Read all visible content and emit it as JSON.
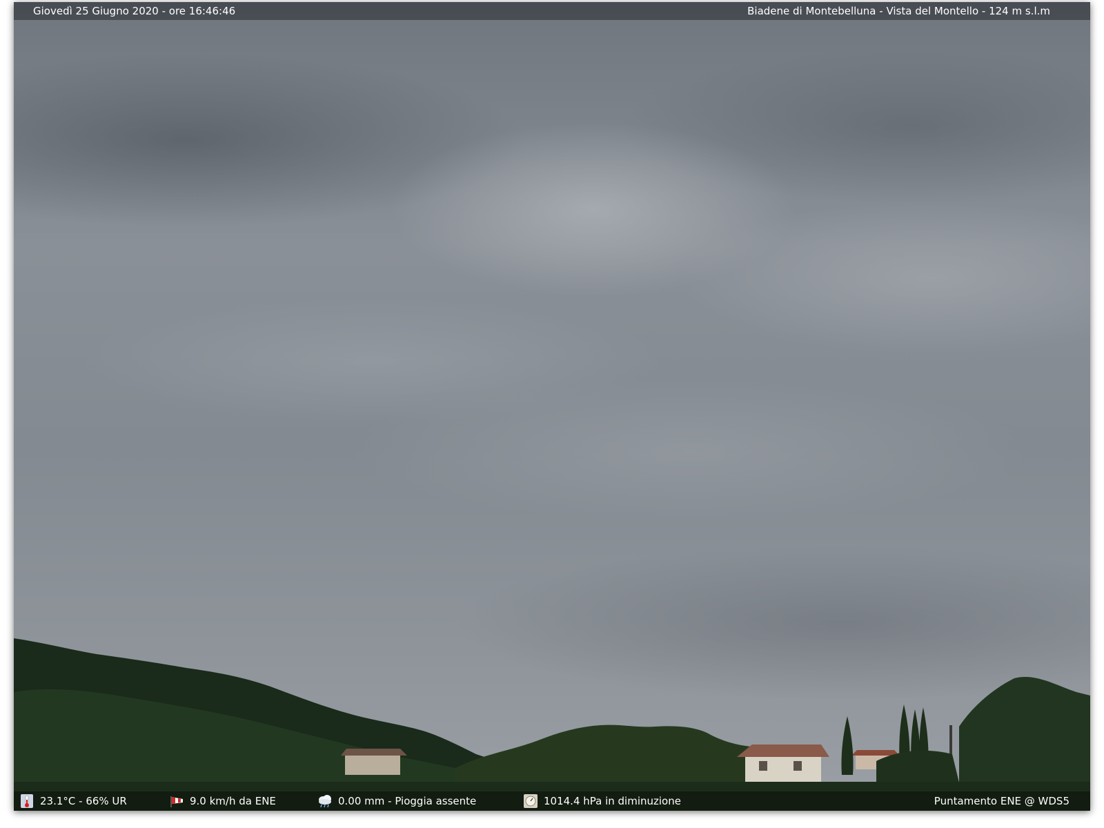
{
  "header": {
    "datetime": "Giovedì 25 Giugno 2020 - ore 16:46:46",
    "location": "Biadene di Montebelluna - Vista del Montello - 124 m s.l.m"
  },
  "footer": {
    "temperature_humidity": "23.1°C - 66% UR",
    "wind": "9.0 km/h da ENE",
    "rain": "0.00 mm - Pioggia assente",
    "pressure": "1014.4 hPa in diminuzione",
    "pointing": "Puntamento ENE  @ WDS5"
  },
  "icons": {
    "temperature": "thermometer-icon",
    "wind": "windsock-icon",
    "rain": "rain-cloud-icon",
    "pressure": "barometer-icon"
  },
  "colors": {
    "sky": "#838a91",
    "hill": "#1b2b1c",
    "trees": "#22331f"
  }
}
